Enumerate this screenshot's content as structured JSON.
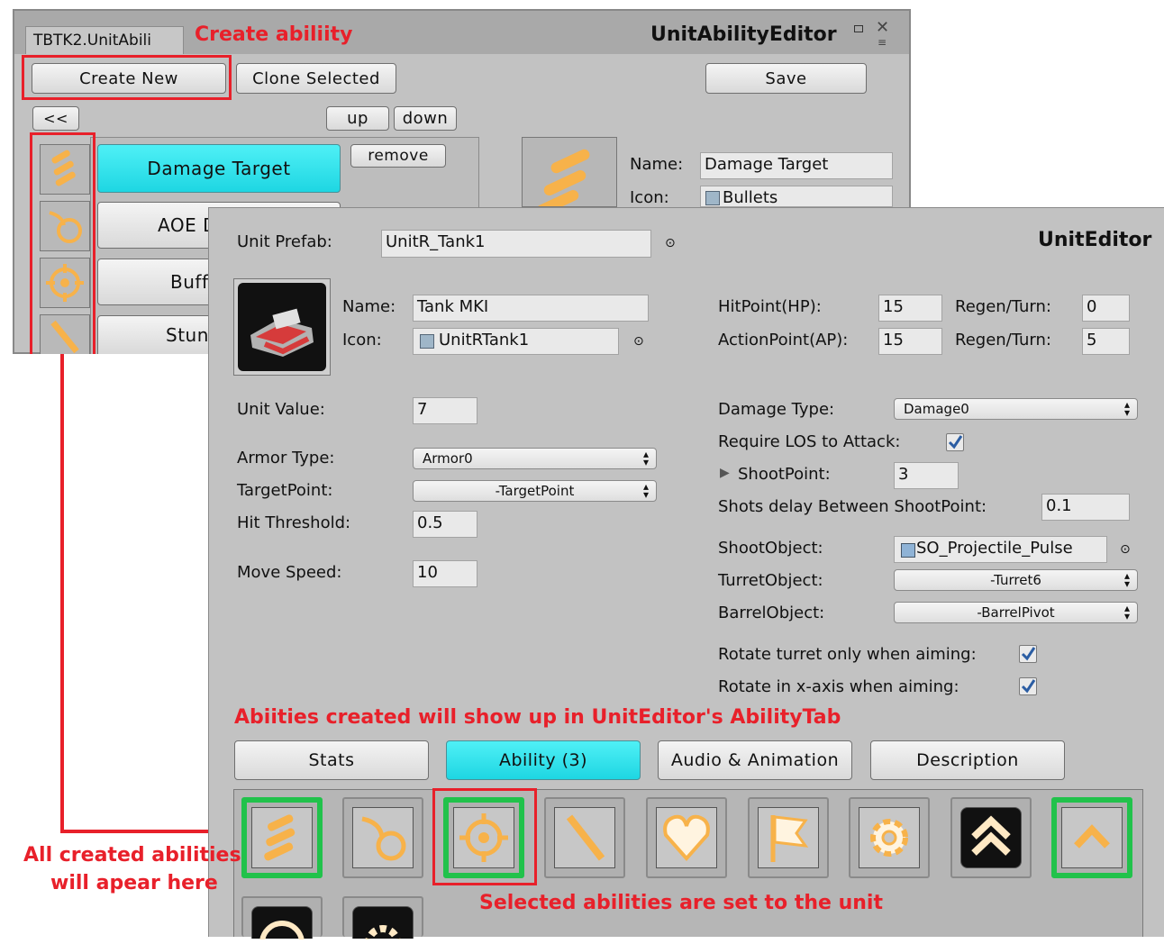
{
  "ability_editor": {
    "tab_label": "TBTK2.UnitAbili",
    "window_title": "UnitAbilityEditor",
    "create_new": "Create New",
    "clone_selected": "Clone Selected",
    "save": "Save",
    "collapse": "<<",
    "up": "up",
    "down": "down",
    "remove": "remove",
    "abilities": [
      "Damage Target",
      "AOE D",
      "Buff",
      "Stun"
    ],
    "name_label": "Name:",
    "name_value": "Damage Target",
    "icon_label": "Icon:",
    "icon_value": "Bullets"
  },
  "unit_editor": {
    "title": "UnitEditor",
    "prefab_label": "Unit Prefab:",
    "prefab_value": "UnitR_Tank1",
    "name_label": "Name:",
    "name_value": "Tank MKI",
    "icon_label": "Icon:",
    "icon_value": "UnitRTank1",
    "hp_label": "HitPoint(HP):",
    "hp_value": "15",
    "hp_regen_label": "Regen/Turn:",
    "hp_regen_value": "0",
    "ap_label": "ActionPoint(AP):",
    "ap_value": "15",
    "ap_regen_label": "Regen/Turn:",
    "ap_regen_value": "5",
    "unit_value_label": "Unit Value:",
    "unit_value": "7",
    "armor_type_label": "Armor Type:",
    "armor_type_value": "Armor0",
    "target_point_label": "TargetPoint:",
    "target_point_value": "-TargetPoint",
    "hit_threshold_label": "Hit Threshold:",
    "hit_threshold_value": "0.5",
    "move_speed_label": "Move Speed:",
    "move_speed_value": "10",
    "damage_type_label": "Damage Type:",
    "damage_type_value": "Damage0",
    "require_los_label": "Require LOS to Attack:",
    "shootpoint_label": "ShootPoint:",
    "shootpoint_value": "3",
    "shots_delay_label": "Shots delay Between ShootPoint:",
    "shots_delay_value": "0.1",
    "shoot_object_label": "ShootObject:",
    "shoot_object_value": "SO_Projectile_Pulse",
    "turret_object_label": "TurretObject:",
    "turret_object_value": "-Turret6",
    "barrel_object_label": "BarrelObject:",
    "barrel_object_value": "-BarrelPivot",
    "rotate_turret_label": "Rotate turret only when aiming:",
    "rotate_x_label": "Rotate in x-axis when aiming:",
    "tabs": [
      "Stats",
      "Ability (3)",
      "Audio & Animation",
      "Description"
    ]
  },
  "annotations": {
    "create_ability": "Create abiliity",
    "abilities_show": "Abiities created will show up in UnitEditor's AbilityTab",
    "all_created_line1": "All created abilities",
    "all_created_line2": "will apear here",
    "selected_set": "Selected abilities are set to the unit"
  },
  "colors": {
    "annotation_red": "#e8202a",
    "selected_green": "#21c24b",
    "active_cyan": "#2fe3ec",
    "panel_gray": "#c2c2c2"
  }
}
